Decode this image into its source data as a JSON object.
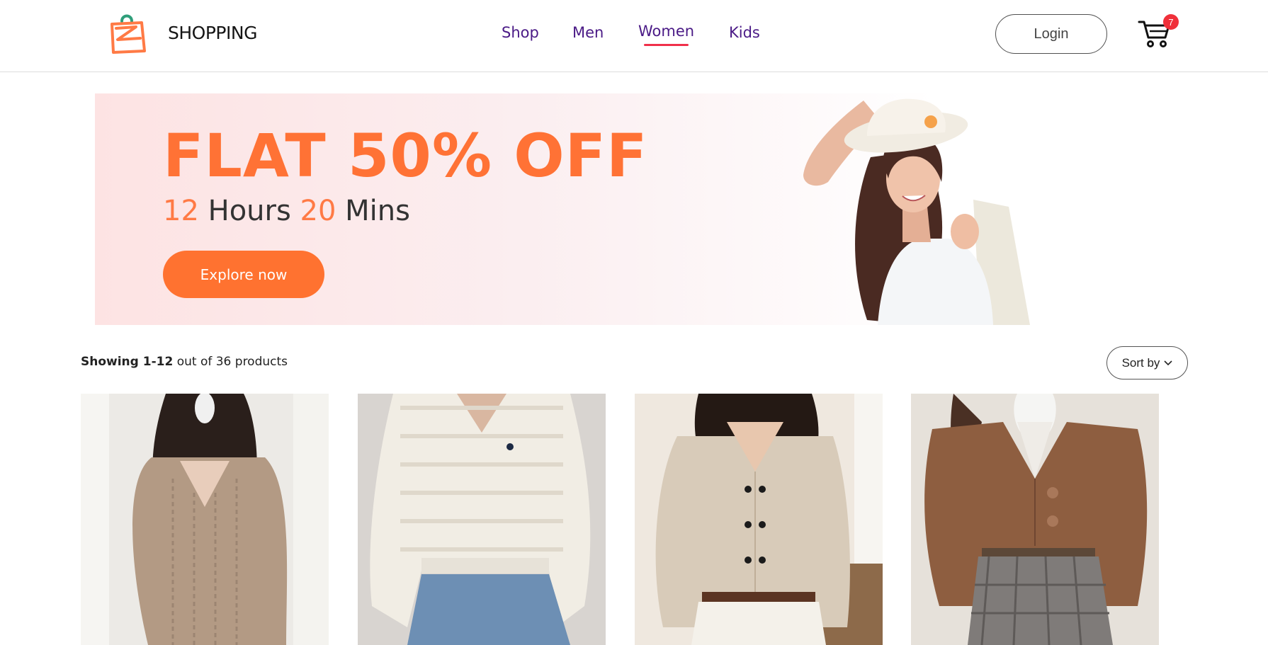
{
  "brand": {
    "name": "SHOPPING",
    "logo_icon": "shopping-bag-icon",
    "colors": {
      "bag": "#ff7a45",
      "handle": "#2f9e7a"
    }
  },
  "nav": {
    "items": [
      {
        "label": "Shop",
        "active": false
      },
      {
        "label": "Men",
        "active": false
      },
      {
        "label": "Women",
        "active": true
      },
      {
        "label": "Kids",
        "active": false
      }
    ],
    "active_underline_color": "#f0304a",
    "text_color": "#4a1a86"
  },
  "header": {
    "login_label": "Login",
    "cart_icon": "cart-icon",
    "cart_count": "7"
  },
  "banner": {
    "headline": "FLAT 50% OFF",
    "timer": {
      "hours_value": "12",
      "hours_unit": "Hours",
      "mins_value": "20",
      "mins_unit": "Mins"
    },
    "cta_label": "Explore now",
    "accent_color": "#ff7230"
  },
  "listing": {
    "showing_range": "Showing 1-12",
    "showing_rest": "out of 36 products",
    "sort_label": "Sort by",
    "sort_icon": "chevron-down-icon"
  },
  "products": [
    {
      "image": "product-photo-beige-knit-dress"
    },
    {
      "image": "product-photo-cream-knit-sweater"
    },
    {
      "image": "product-photo-beige-button-blouse"
    },
    {
      "image": "product-photo-brown-cardigan"
    }
  ]
}
